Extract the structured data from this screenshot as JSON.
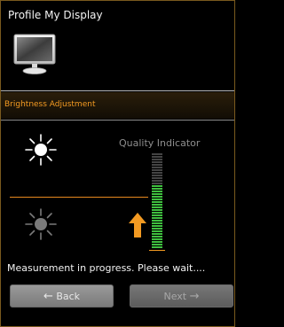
{
  "window": {
    "title": "Profile My Display"
  },
  "section": {
    "title": "Brightness Adjustment"
  },
  "quality": {
    "label": "Quality Indicator",
    "level_fraction": 0.67
  },
  "status": {
    "text": "Measurement in progress. Please wait...."
  },
  "buttons": {
    "back": {
      "arrow": "←",
      "label": "Back"
    },
    "next": {
      "label": "Next",
      "arrow": "→"
    }
  },
  "icons": {
    "monitor": "monitor-icon",
    "sun_bright": "sun-bright-icon",
    "sun_dim": "sun-dim-icon",
    "arrow_up": "arrow-up-icon"
  },
  "colors": {
    "accent": "#f39a22",
    "meter_active": "#3fbf3f",
    "meter_inactive": "#444444",
    "meter_indicator": "#f39a22"
  }
}
